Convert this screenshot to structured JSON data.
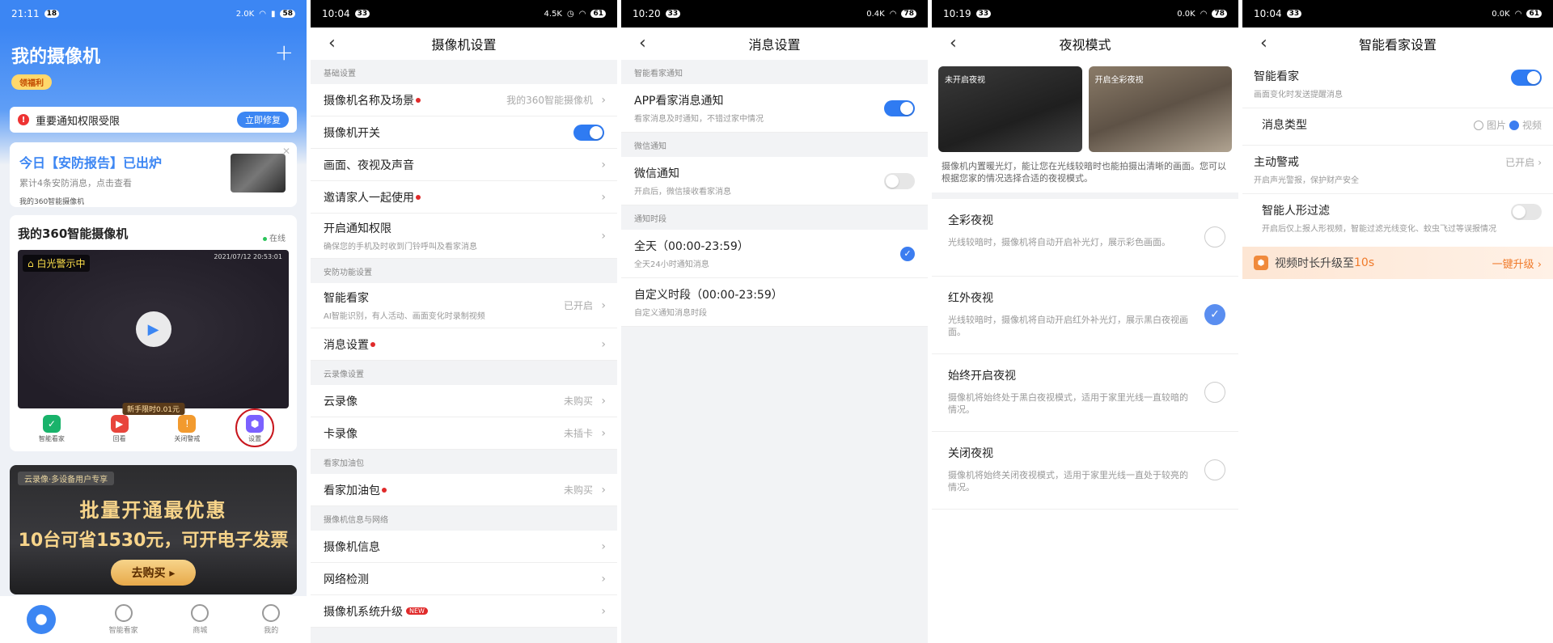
{
  "screen1": {
    "status": {
      "time": "21:11",
      "badge": "18",
      "net": "2.0K",
      "battery": "58"
    },
    "title": "我的摄像机",
    "welfare": "领福利",
    "notice": {
      "text": "重要通知权限受限",
      "action": "立即修复"
    },
    "report": {
      "title": "今日【安防报告】已出炉",
      "desc": "累计4条安防消息，点击查看",
      "camera": "我的360智能摄像机"
    },
    "camera": {
      "name": "我的360智能摄像机",
      "online": "在线",
      "alert": "白光警示中",
      "timestamp": "2021/07/12 20:53:01",
      "promo": "新手限时0.01元",
      "tools": [
        {
          "label": "智能看家",
          "color": "#19b36b"
        },
        {
          "label": "回看",
          "color": "#e8453c"
        },
        {
          "label": "关闭警戒",
          "color": "#f29a2e"
        },
        {
          "label": "设置",
          "color": "#7b61ff"
        }
      ]
    },
    "banner": {
      "tag": "云录像·多设备用户专享",
      "line1": "批量开通最优惠",
      "line2": "10台可省1530元，可开电子发票",
      "button": "去购买"
    },
    "tabs": [
      {
        "label": ""
      },
      {
        "label": "智能看家"
      },
      {
        "label": "商城"
      },
      {
        "label": "我的"
      }
    ]
  },
  "screen2": {
    "status": {
      "time": "10:04",
      "badge": "33",
      "net": "4.5K",
      "battery": "61"
    },
    "title": "摄像机设置",
    "sections": {
      "basic": "基础设置",
      "security": "安防功能设置",
      "cloud": "云录像设置",
      "pack": "看家加油包",
      "info": "摄像机信息与网络"
    },
    "rows": {
      "name_scene": {
        "label": "摄像机名称及场景",
        "value": "我的360智能摄像机"
      },
      "power": {
        "label": "摄像机开关"
      },
      "picture": {
        "label": "画面、夜视及声音"
      },
      "invite": {
        "label": "邀请家人一起使用"
      },
      "notify": {
        "label": "开启通知权限",
        "sub": "确保您的手机及时收到门铃呼叫及看家消息"
      },
      "smart": {
        "label": "智能看家",
        "sub": "AI智能识别，有人活动、画面变化时录制视频",
        "value": "已开启"
      },
      "message": {
        "label": "消息设置"
      },
      "cloud": {
        "label": "云录像",
        "value": "未购买"
      },
      "card": {
        "label": "卡录像",
        "value": "未插卡"
      },
      "pack": {
        "label": "看家加油包",
        "value": "未购买"
      },
      "info": {
        "label": "摄像机信息"
      },
      "network": {
        "label": "网络检测"
      },
      "upgrade": {
        "label": "摄像机系统升级",
        "badge": "NEW"
      }
    }
  },
  "screen3": {
    "status": {
      "time": "10:20",
      "badge": "33",
      "net": "0.4K",
      "battery": "78"
    },
    "title": "消息设置",
    "sections": {
      "smart": "智能看家通知",
      "wechat": "微信通知",
      "period": "通知时段"
    },
    "rows": {
      "app": {
        "label": "APP看家消息通知",
        "sub": "看家消息及时通知，不错过家中情况"
      },
      "wechat": {
        "label": "微信通知",
        "sub": "开启后，微信接收看家消息"
      },
      "allday": {
        "label": "全天（00:00-23:59）",
        "sub": "全天24小时通知消息"
      },
      "custom": {
        "label": "自定义时段（00:00-23:59）",
        "sub": "自定义通知消息时段"
      }
    }
  },
  "screen4": {
    "status": {
      "time": "10:19",
      "badge": "33",
      "net": "0.0K",
      "battery": "78"
    },
    "title": "夜视模式",
    "preview_off": "未开启夜视",
    "preview_on": "开启全彩夜视",
    "desc": "摄像机内置暖光灯，能让您在光线较暗时也能拍摄出清晰的画面。您可以根据您家的情况选择合适的夜视模式。",
    "options": [
      {
        "label": "全彩夜视",
        "sub": "光线较暗时，摄像机将自动开启补光灯，展示彩色画面。"
      },
      {
        "label": "红外夜视",
        "sub": "光线较暗时，摄像机将自动开启红外补光灯，展示黑白夜视画面。"
      },
      {
        "label": "始终开启夜视",
        "sub": "摄像机将始终处于黑白夜视模式，适用于家里光线一直较暗的情况。"
      },
      {
        "label": "关闭夜视",
        "sub": "摄像机将始终关闭夜视模式，适用于家里光线一直处于较亮的情况。"
      }
    ]
  },
  "screen5": {
    "status": {
      "time": "10:04",
      "badge": "33",
      "net": "0.0K",
      "battery": "61"
    },
    "title": "智能看家设置",
    "smart": {
      "label": "智能看家",
      "sub": "画面变化时发送提醒消息"
    },
    "msgtype": {
      "label": "消息类型",
      "opt1": "图片",
      "opt2": "视频"
    },
    "alarm": {
      "label": "主动警戒",
      "sub": "开启声光警报，保护财产安全",
      "value": "已开启"
    },
    "human": {
      "label": "智能人形过滤",
      "sub": "开启后仅上报人形视频，智能过滤光线变化、蚊虫飞过等误报情况"
    },
    "upgrade": {
      "text": "视频时长升级至",
      "highlight": "10s",
      "action": "一键升级"
    }
  }
}
